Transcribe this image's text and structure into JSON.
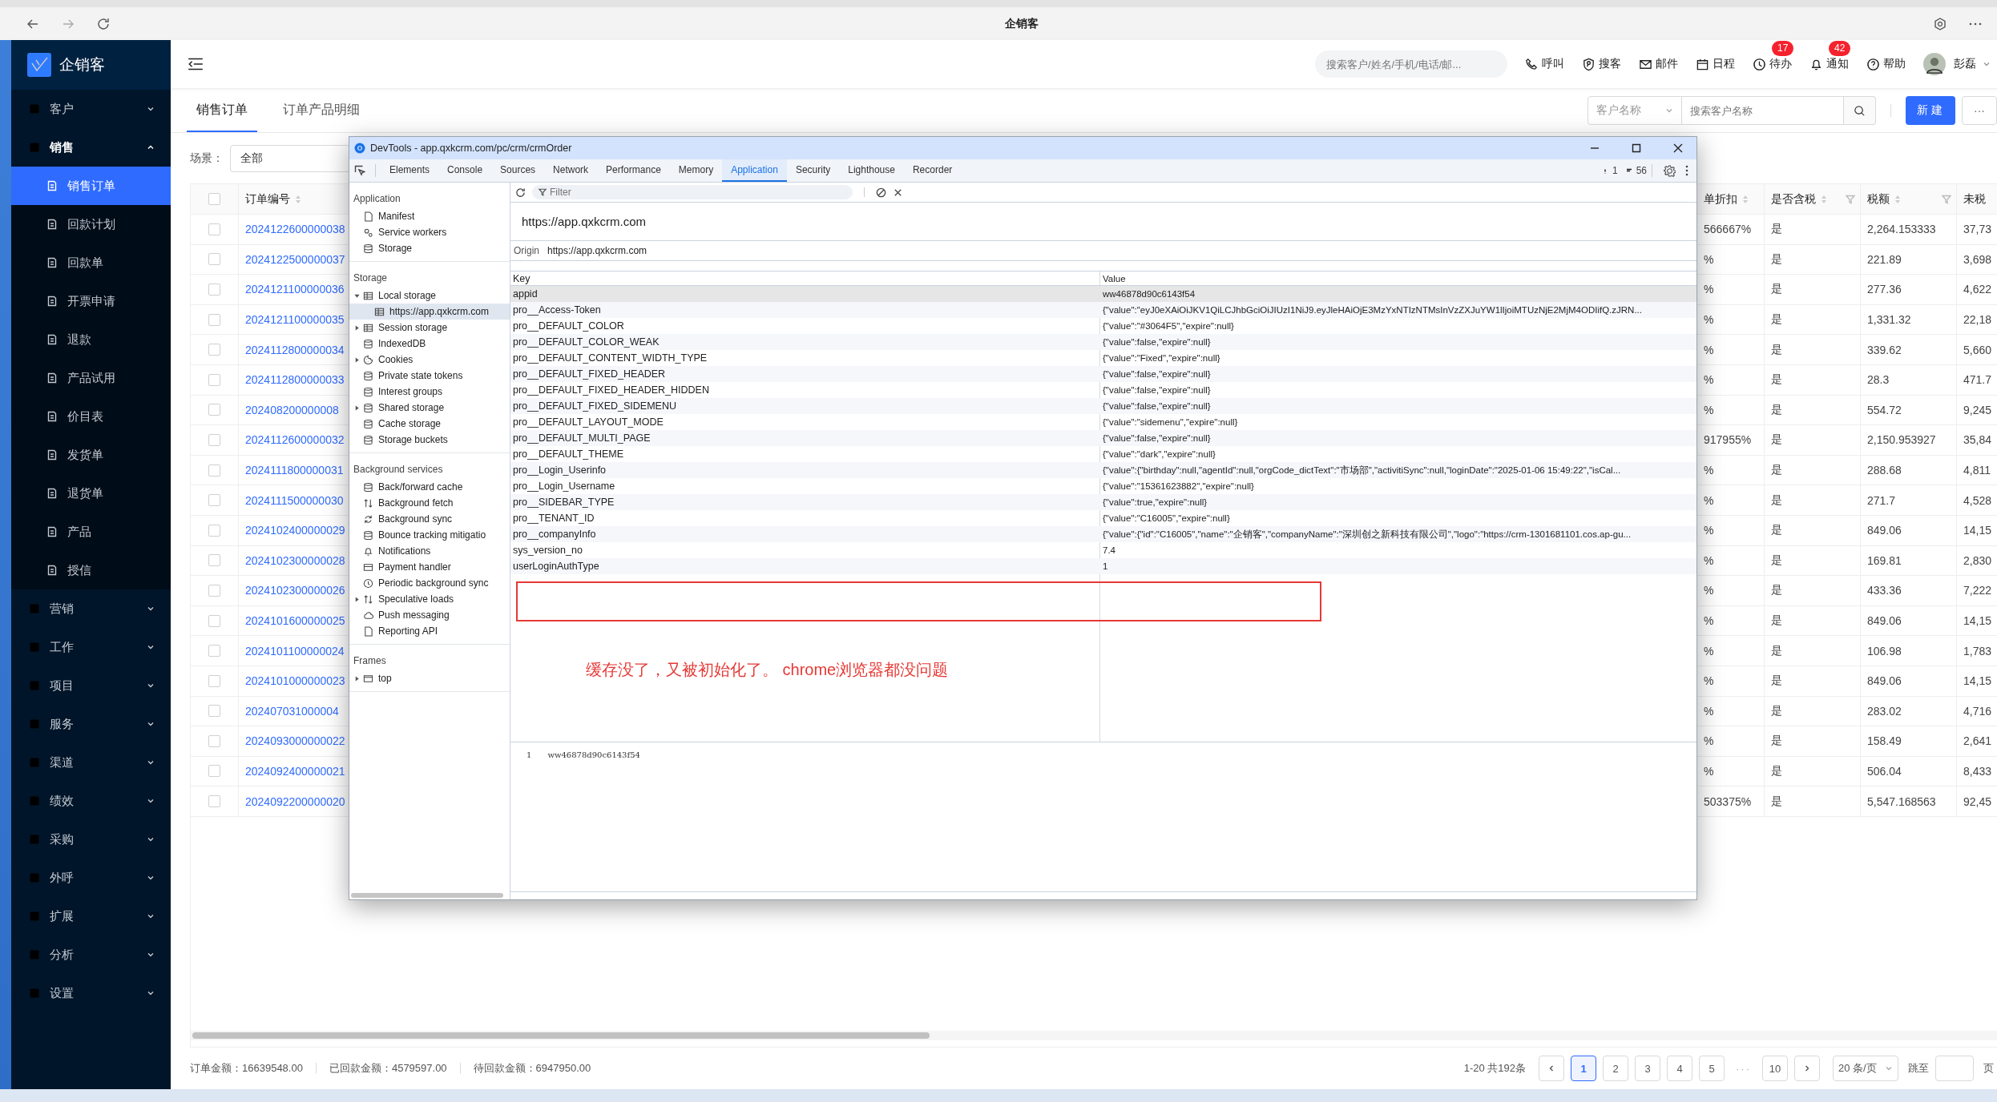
{
  "browser": {
    "title": "企销客"
  },
  "app": {
    "logo": "企销客"
  },
  "sidebar": {
    "items": [
      {
        "label": "客户",
        "expanded": false
      },
      {
        "label": "销售",
        "expanded": true,
        "children": [
          {
            "label": "销售订单",
            "selected": true
          },
          {
            "label": "回款计划",
            "selected": false
          },
          {
            "label": "回款单",
            "selected": false
          },
          {
            "label": "开票申请",
            "selected": false
          },
          {
            "label": "退款",
            "selected": false
          },
          {
            "label": "产品试用",
            "selected": false
          },
          {
            "label": "价目表",
            "selected": false
          },
          {
            "label": "发货单",
            "selected": false
          },
          {
            "label": "退货单",
            "selected": false
          },
          {
            "label": "产品",
            "selected": false
          },
          {
            "label": "授信",
            "selected": false
          }
        ]
      },
      {
        "label": "营销",
        "expanded": false
      },
      {
        "label": "工作",
        "expanded": false
      },
      {
        "label": "项目",
        "expanded": false
      },
      {
        "label": "服务",
        "expanded": false
      },
      {
        "label": "渠道",
        "expanded": false
      },
      {
        "label": "绩效",
        "expanded": false
      },
      {
        "label": "采购",
        "expanded": false
      },
      {
        "label": "外呼",
        "expanded": false
      },
      {
        "label": "扩展",
        "expanded": false
      },
      {
        "label": "分析",
        "expanded": false
      },
      {
        "label": "设置",
        "expanded": false
      }
    ]
  },
  "header": {
    "search": {
      "placeholder": "搜索客户/姓名/手机/电话/邮..."
    },
    "tools": [
      {
        "label": "呼叫"
      },
      {
        "label": "搜客"
      },
      {
        "label": "邮件"
      },
      {
        "label": "日程"
      },
      {
        "label": "待办",
        "badge": "17"
      },
      {
        "label": "通知",
        "badge": "42"
      },
      {
        "label": "帮助"
      }
    ],
    "user": "彭磊"
  },
  "tabs": [
    {
      "label": "销售订单",
      "selected": true
    },
    {
      "label": "订单产品明细",
      "selected": false
    }
  ],
  "toolbar": {
    "field_select": "客户名称",
    "search": {
      "placeholder": "搜索客户名称"
    },
    "new_button": "新建",
    "more_button": "···"
  },
  "scene": {
    "label": "场景：",
    "value": "全部"
  },
  "table": {
    "select_all": {
      "checked": false
    },
    "columns": [
      "订单编号",
      "单折扣",
      "是否含税",
      "税额",
      "未税"
    ],
    "rows": [
      {
        "checked": false,
        "order_no": "2024122600000038",
        "discount": "566667%",
        "tax_included": "是",
        "tax": "2,264.153333",
        "untaxed": "37,73"
      },
      {
        "checked": false,
        "order_no": "2024122500000037",
        "discount": "%",
        "tax_included": "是",
        "tax": "221.89",
        "untaxed": "3,698"
      },
      {
        "checked": false,
        "order_no": "2024121100000036",
        "discount": "%",
        "tax_included": "是",
        "tax": "277.36",
        "untaxed": "4,622"
      },
      {
        "checked": false,
        "order_no": "2024121100000035",
        "discount": "%",
        "tax_included": "是",
        "tax": "1,331.32",
        "untaxed": "22,18"
      },
      {
        "checked": false,
        "order_no": "2024112800000034",
        "discount": "%",
        "tax_included": "是",
        "tax": "339.62",
        "untaxed": "5,660"
      },
      {
        "checked": false,
        "order_no": "2024112800000033",
        "discount": "%",
        "tax_included": "是",
        "tax": "28.3",
        "untaxed": "471.7"
      },
      {
        "checked": false,
        "order_no": "202408200000008",
        "discount": "%",
        "tax_included": "是",
        "tax": "554.72",
        "untaxed": "9,245"
      },
      {
        "checked": false,
        "order_no": "2024112600000032",
        "discount": "917955%",
        "tax_included": "是",
        "tax": "2,150.953927",
        "untaxed": "35,84"
      },
      {
        "checked": false,
        "order_no": "2024111800000031",
        "discount": "%",
        "tax_included": "是",
        "tax": "288.68",
        "untaxed": "4,811"
      },
      {
        "checked": false,
        "order_no": "2024111500000030",
        "discount": "%",
        "tax_included": "是",
        "tax": "271.7",
        "untaxed": "4,528"
      },
      {
        "checked": false,
        "order_no": "2024102400000029",
        "discount": "%",
        "tax_included": "是",
        "tax": "849.06",
        "untaxed": "14,15"
      },
      {
        "checked": false,
        "order_no": "2024102300000028",
        "discount": "%",
        "tax_included": "是",
        "tax": "169.81",
        "untaxed": "2,830"
      },
      {
        "checked": false,
        "order_no": "2024102300000026",
        "discount": "%",
        "tax_included": "是",
        "tax": "433.36",
        "untaxed": "7,222"
      },
      {
        "checked": false,
        "order_no": "2024101600000025",
        "discount": "%",
        "tax_included": "是",
        "tax": "849.06",
        "untaxed": "14,15"
      },
      {
        "checked": false,
        "order_no": "2024101100000024",
        "discount": "%",
        "tax_included": "是",
        "tax": "106.98",
        "untaxed": "1,783"
      },
      {
        "checked": false,
        "order_no": "2024101000000023",
        "discount": "%",
        "tax_included": "是",
        "tax": "849.06",
        "untaxed": "14,15"
      },
      {
        "checked": false,
        "order_no": "202407031000004",
        "discount": "%",
        "tax_included": "是",
        "tax": "283.02",
        "untaxed": "4,716"
      },
      {
        "checked": false,
        "order_no": "2024093000000022",
        "discount": "%",
        "tax_included": "是",
        "tax": "158.49",
        "untaxed": "2,641"
      },
      {
        "checked": false,
        "order_no": "2024092400000021",
        "discount": "%",
        "tax_included": "是",
        "tax": "506.04",
        "untaxed": "8,433"
      },
      {
        "checked": false,
        "order_no": "2024092200000020",
        "discount": "503375%",
        "tax_included": "是",
        "tax": "5,547.168563",
        "untaxed": "92,45"
      }
    ]
  },
  "footer": {
    "amounts": [
      "订单金额：16639548.00",
      "已回款金额：4579597.00",
      "待回款金额：6947950.00"
    ],
    "pagination": {
      "summary": "1-20 共192条",
      "pages": [
        {
          "kind": "page",
          "label": "1",
          "selected": true
        },
        {
          "kind": "page",
          "label": "2",
          "selected": false
        },
        {
          "kind": "page",
          "label": "3",
          "selected": false
        },
        {
          "kind": "page",
          "label": "4",
          "selected": false
        },
        {
          "kind": "page",
          "label": "5",
          "selected": false
        },
        {
          "kind": "ellipsis",
          "label": "···"
        },
        {
          "kind": "page",
          "label": "10",
          "selected": false
        }
      ],
      "page_size": "20 条/页",
      "jump_label": "跳至",
      "page_unit": "页"
    }
  },
  "devtools": {
    "title": "DevTools - app.qxkcrm.com/pc/crm/crmOrder",
    "tabs": [
      {
        "label": "Elements",
        "selected": false
      },
      {
        "label": "Console",
        "selected": false
      },
      {
        "label": "Sources",
        "selected": false
      },
      {
        "label": "Network",
        "selected": false
      },
      {
        "label": "Performance",
        "selected": false
      },
      {
        "label": "Memory",
        "selected": false
      },
      {
        "label": "Application",
        "selected": true
      },
      {
        "label": "Security",
        "selected": false
      },
      {
        "label": "Lighthouse",
        "selected": false
      },
      {
        "label": "Recorder",
        "selected": false
      }
    ],
    "warnings": "1",
    "messages": "56",
    "sections": [
      {
        "title": "Application",
        "items": [
          {
            "label": "Manifest",
            "kind": "file",
            "selected": false
          },
          {
            "label": "Service workers",
            "kind": "gears",
            "selected": false
          },
          {
            "label": "Storage",
            "kind": "database",
            "selected": false
          }
        ]
      },
      {
        "title": "Storage",
        "items": [
          {
            "label": "Local storage",
            "kind": "table",
            "selected": false,
            "expanded": true,
            "children": [
              {
                "label": "https://app.qxkcrm.com",
                "kind": "table",
                "selected": true
              }
            ]
          },
          {
            "label": "Session storage",
            "kind": "table",
            "selected": false,
            "expanded": false
          },
          {
            "label": "IndexedDB",
            "kind": "database",
            "selected": false
          },
          {
            "label": "Cookies",
            "kind": "cookie",
            "selected": false,
            "expanded": false
          },
          {
            "label": "Private state tokens",
            "kind": "database",
            "selected": false
          },
          {
            "label": "Interest groups",
            "kind": "database",
            "selected": false
          },
          {
            "label": "Shared storage",
            "kind": "database",
            "selected": false,
            "expanded": false
          },
          {
            "label": "Cache storage",
            "kind": "database",
            "selected": false
          },
          {
            "label": "Storage buckets",
            "kind": "database",
            "selected": false
          }
        ]
      },
      {
        "title": "Background services",
        "items": [
          {
            "label": "Back/forward cache",
            "kind": "database",
            "selected": false
          },
          {
            "label": "Background fetch",
            "kind": "updown",
            "selected": false
          },
          {
            "label": "Background sync",
            "kind": "sync",
            "selected": false
          },
          {
            "label": "Bounce tracking mitigatio",
            "kind": "database",
            "selected": false
          },
          {
            "label": "Notifications",
            "kind": "bell",
            "selected": false
          },
          {
            "label": "Payment handler",
            "kind": "card",
            "selected": false
          },
          {
            "label": "Periodic background sync",
            "kind": "clock",
            "selected": false
          },
          {
            "label": "Speculative loads",
            "kind": "updown",
            "selected": false,
            "expanded": false
          },
          {
            "label": "Push messaging",
            "kind": "cloud",
            "selected": false
          },
          {
            "label": "Reporting API",
            "kind": "file",
            "selected": false
          }
        ]
      },
      {
        "title": "Frames",
        "items": [
          {
            "label": "top",
            "kind": "frame",
            "selected": false,
            "expanded": false
          }
        ]
      }
    ],
    "filter": {
      "placeholder": "Filter"
    },
    "origin_title": "https://app.qxkcrm.com",
    "origin_label": "Origin",
    "origin_value": "https://app.qxkcrm.com",
    "columns": [
      "Key",
      "Value"
    ],
    "rows": [
      {
        "key": "appid",
        "value": "ww46878d90c6143f54",
        "selected": true
      },
      {
        "key": "pro__Access-Token",
        "value": "{\"value\":\"eyJ0eXAiOiJKV1QiLCJhbGciOiJIUzI1NiJ9.eyJleHAiOjE3MzYxNTIzNTMsInVzZXJuYW1lIjoiMTUzNjE2MjM4ODIifQ.zJRN...",
        "selected": false
      },
      {
        "key": "pro__DEFAULT_COLOR",
        "value": "{\"value\":\"#3064F5\",\"expire\":null}",
        "selected": false
      },
      {
        "key": "pro__DEFAULT_COLOR_WEAK",
        "value": "{\"value\":false,\"expire\":null}",
        "selected": false
      },
      {
        "key": "pro__DEFAULT_CONTENT_WIDTH_TYPE",
        "value": "{\"value\":\"Fixed\",\"expire\":null}",
        "selected": false
      },
      {
        "key": "pro__DEFAULT_FIXED_HEADER",
        "value": "{\"value\":false,\"expire\":null}",
        "selected": false
      },
      {
        "key": "pro__DEFAULT_FIXED_HEADER_HIDDEN",
        "value": "{\"value\":false,\"expire\":null}",
        "selected": false
      },
      {
        "key": "pro__DEFAULT_FIXED_SIDEMENU",
        "value": "{\"value\":false,\"expire\":null}",
        "selected": false
      },
      {
        "key": "pro__DEFAULT_LAYOUT_MODE",
        "value": "{\"value\":\"sidemenu\",\"expire\":null}",
        "selected": false
      },
      {
        "key": "pro__DEFAULT_MULTI_PAGE",
        "value": "{\"value\":false,\"expire\":null}",
        "selected": false
      },
      {
        "key": "pro__DEFAULT_THEME",
        "value": "{\"value\":\"dark\",\"expire\":null}",
        "selected": false
      },
      {
        "key": "pro__Login_Userinfo",
        "value": "{\"value\":{\"birthday\":null,\"agentId\":null,\"orgCode_dictText\":\"市场部\",\"activitiSync\":null,\"loginDate\":\"2025-01-06 15:49:22\",\"isCal...",
        "selected": false
      },
      {
        "key": "pro__Login_Username",
        "value": "{\"value\":\"15361623882\",\"expire\":null}",
        "selected": false
      },
      {
        "key": "pro__SIDEBAR_TYPE",
        "value": "{\"value\":true,\"expire\":null}",
        "selected": false
      },
      {
        "key": "pro__TENANT_ID",
        "value": "{\"value\":\"C16005\",\"expire\":null}",
        "selected": false
      },
      {
        "key": "pro__companyInfo",
        "value": "{\"value\":{\"id\":\"C16005\",\"name\":\"企销客\",\"companyName\":\"深圳创之新科技有限公司\",\"logo\":\"https://crm-1301681101.cos.ap-gu...",
        "selected": false
      },
      {
        "key": "sys_version_no",
        "value": "7.4",
        "selected": false
      },
      {
        "key": "userLoginAuthType",
        "value": "1",
        "selected": false
      }
    ],
    "preview": {
      "line": "1",
      "text": "ww46878d90c6143f54"
    },
    "annotation": "缓存没了，又被初始化了。 chrome浏览器都没问题"
  }
}
